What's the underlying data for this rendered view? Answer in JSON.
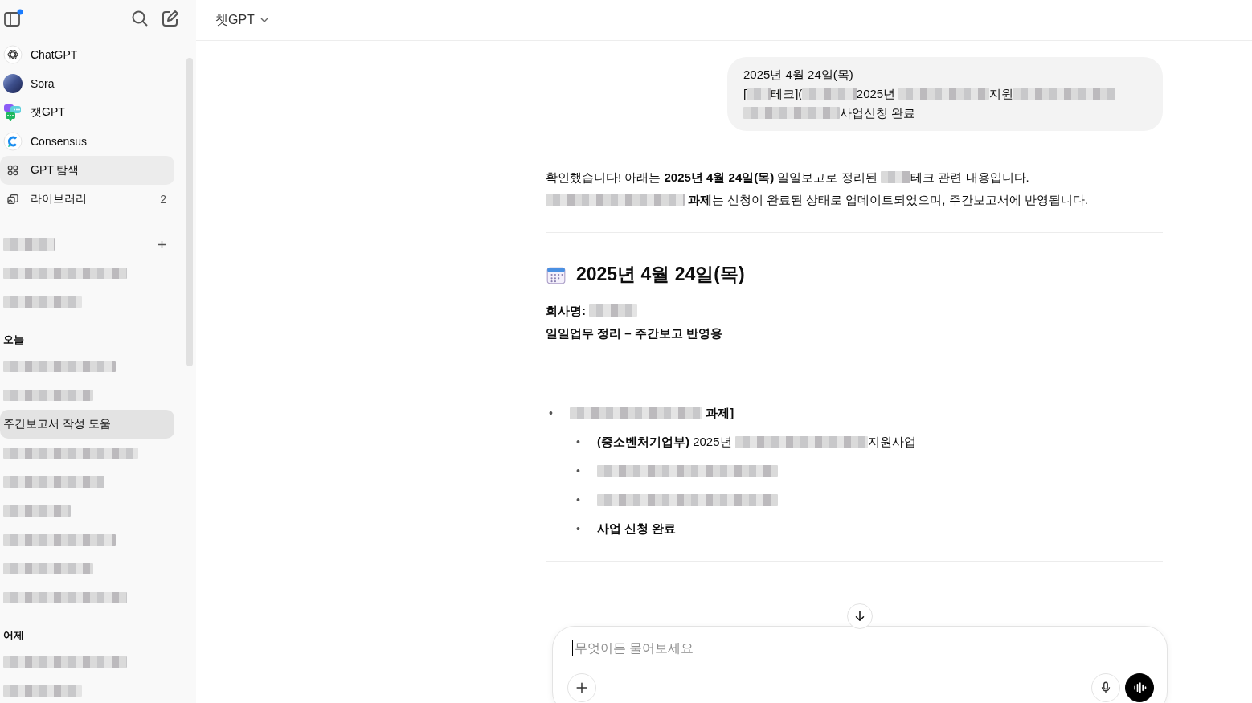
{
  "sidebar": {
    "nav": [
      {
        "label": "ChatGPT",
        "selected": false
      },
      {
        "label": "Sora",
        "selected": false
      },
      {
        "label": "챗GPT",
        "selected": false
      },
      {
        "label": "Consensus",
        "selected": false
      },
      {
        "label": "GPT 탐색",
        "selected": true
      },
      {
        "label": "라이브러리",
        "count": "2",
        "selected": false
      }
    ],
    "projects": {
      "heading": {
        "kind": "redacted"
      },
      "items": [
        {
          "kind": "redacted",
          "selected": false
        },
        {
          "kind": "redacted",
          "selected": false
        }
      ]
    },
    "history": [
      {
        "heading": "오늘",
        "items": [
          {
            "kind": "redacted",
            "selected": false
          },
          {
            "kind": "redacted",
            "selected": false
          },
          {
            "kind": "text",
            "title": "주간보고서 작성 도움",
            "selected": true
          },
          {
            "kind": "redacted",
            "selected": false
          },
          {
            "kind": "redacted",
            "selected": false
          },
          {
            "kind": "redacted",
            "selected": false
          },
          {
            "kind": "redacted",
            "selected": false
          },
          {
            "kind": "redacted",
            "selected": false
          },
          {
            "kind": "redacted",
            "selected": false
          }
        ]
      },
      {
        "heading": "어제",
        "items": [
          {
            "kind": "redacted",
            "selected": false
          },
          {
            "kind": "redacted",
            "selected": false
          }
        ]
      }
    ]
  },
  "header": {
    "title": "챗GPT"
  },
  "user_message": {
    "lines": [
      [
        {
          "kind": "text",
          "text": "2025년 4월 24일(목)"
        }
      ],
      [
        {
          "kind": "text",
          "text": "["
        },
        {
          "kind": "redacted"
        },
        {
          "kind": "text",
          "text": "테크]("
        },
        {
          "kind": "redacted"
        },
        {
          "kind": "text",
          "text": "2025년 "
        },
        {
          "kind": "redacted"
        },
        {
          "kind": "text",
          "text": "지원"
        },
        {
          "kind": "redacted"
        }
      ],
      [
        {
          "kind": "redacted"
        },
        {
          "kind": "text",
          "text": "사업신청 완료"
        }
      ]
    ]
  },
  "assistant_message": {
    "blocks": [
      {
        "kind": "paragraph",
        "segments": [
          {
            "kind": "text",
            "text": "확인했습니다! 아래는 **2025년 4월 24일(목)** 일일보고로 정리된 "
          },
          {
            "kind": "redacted"
          },
          {
            "kind": "text",
            "text": "테크 관련 내용입니다."
          }
        ]
      },
      {
        "kind": "paragraph",
        "segments": [
          {
            "kind": "redacted"
          },
          {
            "kind": "text",
            "text": " **과제**는 신청이 완료된 상태로 업데이트되었으며, 주간보고서에 반영됩니다."
          }
        ]
      },
      {
        "kind": "rule"
      },
      {
        "kind": "heading",
        "text": "2025년 4월 24일(목)"
      },
      {
        "kind": "paragraph",
        "bold": true,
        "segments": [
          {
            "kind": "text",
            "text": "회사명: "
          },
          {
            "kind": "redacted"
          }
        ]
      },
      {
        "kind": "paragraph",
        "bold": true,
        "segments": [
          {
            "kind": "text",
            "text": "일일업무 정리 – 주간보고 반영용"
          }
        ]
      },
      {
        "kind": "rule"
      },
      {
        "kind": "list",
        "items": [
          {
            "marker": "•",
            "segments": [
              {
                "kind": "redacted"
              },
              {
                "kind": "text",
                "text": " **과제]**"
              }
            ],
            "children": [
              {
                "marker": "•",
                "segments": [
                  {
                    "kind": "text",
                    "text": "**(중소벤처기업부)** 2025년 "
                  },
                  {
                    "kind": "redacted"
                  },
                  {
                    "kind": "text",
                    "text": "지원사업"
                  }
                ]
              },
              {
                "marker": "•",
                "segments": [
                  {
                    "kind": "redacted"
                  }
                ]
              },
              {
                "marker": "•",
                "segments": [
                  {
                    "kind": "redacted"
                  }
                ]
              },
              {
                "marker": "•",
                "segments": [
                  {
                    "kind": "text",
                    "text": "**사업 신청 완료**"
                  }
                ]
              }
            ]
          }
        ]
      },
      {
        "kind": "rule"
      }
    ]
  },
  "composer": {
    "placeholder": "무엇이든 물어보세요"
  }
}
